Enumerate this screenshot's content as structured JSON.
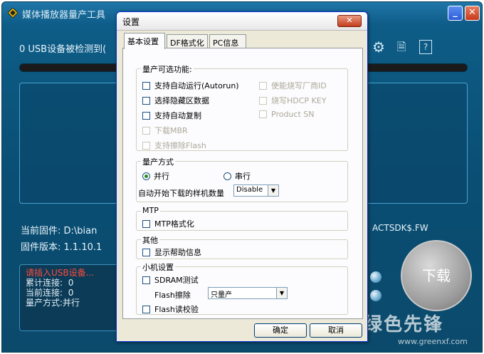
{
  "main": {
    "title": "媒体播放器量产工具",
    "usb_status": "0 USB设备被检测到(",
    "firmware_line": "当前固件: D:\\bian",
    "firmware_tail": "ACTSDK$.FW",
    "version_line": "固件版本: 1.1.10.1",
    "status": {
      "insert_msg": "请插入USB设备...",
      "total_label": "累计连接:",
      "total_value": "0",
      "current_label": "当前连接:",
      "current_value": "0",
      "mode_label": "量产方式:",
      "mode_value": "并行"
    },
    "download_label": "下载",
    "watermark": "绿色先锋",
    "watermark_url": "www.greenxf.com",
    "icons": [
      "app-logo-icon",
      "gear-icon",
      "document-icon",
      "help-icon"
    ]
  },
  "dialog": {
    "title": "设置",
    "close_glyph": "✕",
    "tabs": [
      "基本设置",
      "DF格式化",
      "PC信息"
    ],
    "optional": {
      "label": "量产可选功能:",
      "items": [
        {
          "text": "支持自动运行(Autorun)",
          "enabled": true
        },
        {
          "text": "选择隐藏区数据",
          "enabled": true
        },
        {
          "text": "支持自动复制",
          "enabled": true
        },
        {
          "text": "下载MBR",
          "enabled": false
        },
        {
          "text": "支持擦除Flash",
          "enabled": false
        },
        {
          "text": "使能烧写厂商ID",
          "enabled": false
        },
        {
          "text": "烧写HDCP KEY",
          "enabled": false
        },
        {
          "text": "Product SN",
          "enabled": false
        }
      ]
    },
    "mode": {
      "label": "量产方式",
      "parallel": "并行",
      "serial": "串行",
      "selected": "parallel",
      "auto_start_label": "自动开始下载的样机数量",
      "auto_start_value": "Disable"
    },
    "mtp": {
      "label": "MTP",
      "checkbox": "MTP格式化"
    },
    "other": {
      "label": "其他",
      "checkbox": "显示帮助信息"
    },
    "small": {
      "label": "小机设置",
      "sdram": "SDRAM测试",
      "flash_erase_label": "Flash擦除",
      "flash_erase_value": "只量产",
      "flash_verify": "Flash读校验"
    },
    "ok_label": "确定",
    "cancel_label": "取消"
  }
}
